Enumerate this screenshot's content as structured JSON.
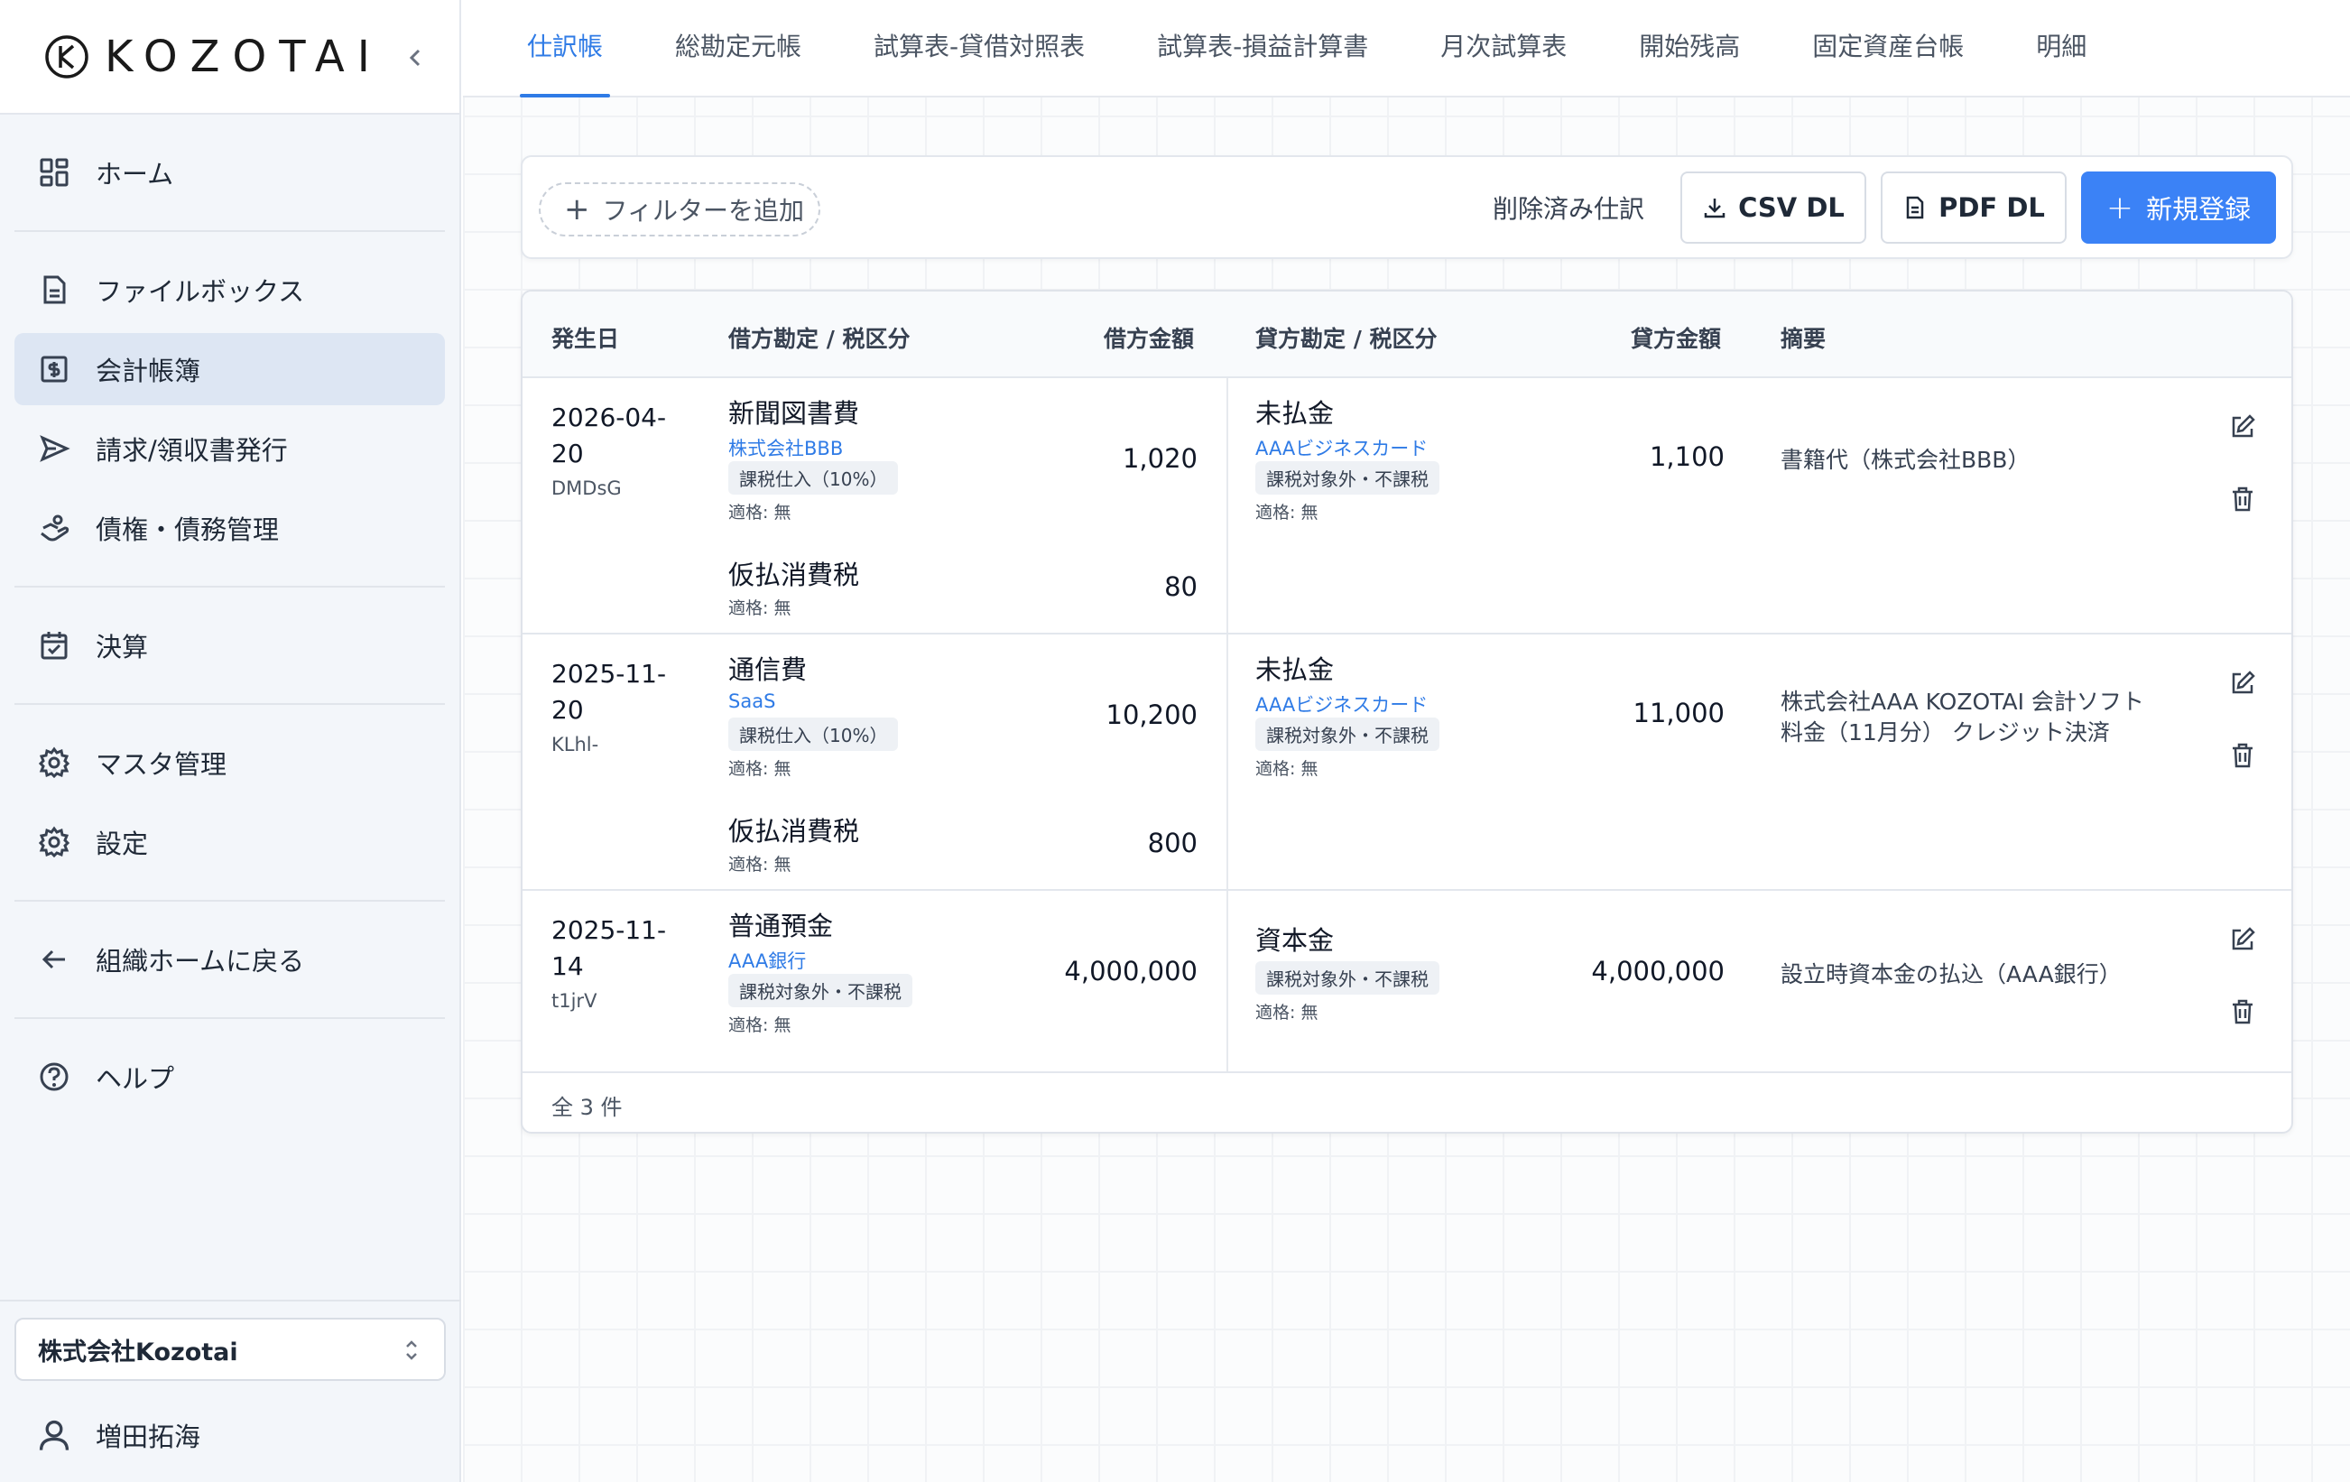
{
  "sidebar": {
    "logo_text": "KOZOTAI",
    "items": [
      {
        "label": "ホーム",
        "icon": "grid-icon"
      },
      {
        "label": "ファイルボックス",
        "icon": "file-icon"
      },
      {
        "label": "会計帳簿",
        "icon": "ledger-icon"
      },
      {
        "label": "請求/領収書発行",
        "icon": "send-icon"
      },
      {
        "label": "債権・債務管理",
        "icon": "handshake-icon"
      },
      {
        "label": "決算",
        "icon": "calendar-check-icon"
      },
      {
        "label": "マスタ管理",
        "icon": "gear-icon"
      },
      {
        "label": "設定",
        "icon": "gear-icon"
      },
      {
        "label": "組織ホームに戻る",
        "icon": "arrow-left-icon"
      },
      {
        "label": "ヘルプ",
        "icon": "help-icon"
      }
    ],
    "org_name": "株式会社Kozotai",
    "user_name": "増田拓海"
  },
  "tabs": [
    "仕訳帳",
    "総勘定元帳",
    "試算表-貸借対照表",
    "試算表-損益計算書",
    "月次試算表",
    "開始残高",
    "固定資産台帳",
    "明細"
  ],
  "toolbar": {
    "filter_label": "フィルターを追加",
    "deleted_label": "削除済み仕訳",
    "csv_label": "CSV DL",
    "pdf_label": "PDF DL",
    "new_label": "新規登録"
  },
  "table": {
    "headers": {
      "date": "発生日",
      "debit_account": "借方勘定 / 税区分",
      "debit_amount": "借方金額",
      "credit_account": "貸方勘定 / 税区分",
      "credit_amount": "貸方金額",
      "memo": "摘要"
    },
    "rows": [
      {
        "date": "2026-04-20",
        "code": "DMDsG",
        "debit": [
          {
            "account": "新聞図書費",
            "sub": "株式会社BBB",
            "tax": "課税仕入（10%）",
            "qual": "適格: 無",
            "amount": "1,020"
          },
          {
            "account": "仮払消費税",
            "qual": "適格: 無",
            "amount": "80"
          }
        ],
        "credit": {
          "account": "未払金",
          "sub": "AAAビジネスカード",
          "tax": "課税対象外・不課税",
          "qual": "適格: 無",
          "amount": "1,100"
        },
        "memo": "書籍代（株式会社BBB）"
      },
      {
        "date": "2025-11-20",
        "code": "KLhl-",
        "debit": [
          {
            "account": "通信費",
            "sub": "SaaS",
            "tax": "課税仕入（10%）",
            "qual": "適格: 無",
            "amount": "10,200"
          },
          {
            "account": "仮払消費税",
            "qual": "適格: 無",
            "amount": "800"
          }
        ],
        "credit": {
          "account": "未払金",
          "sub": "AAAビジネスカード",
          "tax": "課税対象外・不課税",
          "qual": "適格: 無",
          "amount": "11,000"
        },
        "memo": "株式会社AAA KOZOTAI 会計ソフト料金（11月分） クレジット決済"
      },
      {
        "date": "2025-11-14",
        "code": "t1jrV",
        "debit": [
          {
            "account": "普通預金",
            "sub": "AAA銀行",
            "tax": "課税対象外・不課税",
            "qual": "適格: 無",
            "amount": "4,000,000"
          }
        ],
        "credit": {
          "account": "資本金",
          "tax": "課税対象外・不課税",
          "qual": "適格: 無",
          "amount": "4,000,000"
        },
        "memo": "設立時資本金の払込（AAA銀行）"
      }
    ],
    "footer": "全 3 件"
  },
  "colors": {
    "accent": "#3b82f6",
    "active_bg": "#dde6f3"
  }
}
